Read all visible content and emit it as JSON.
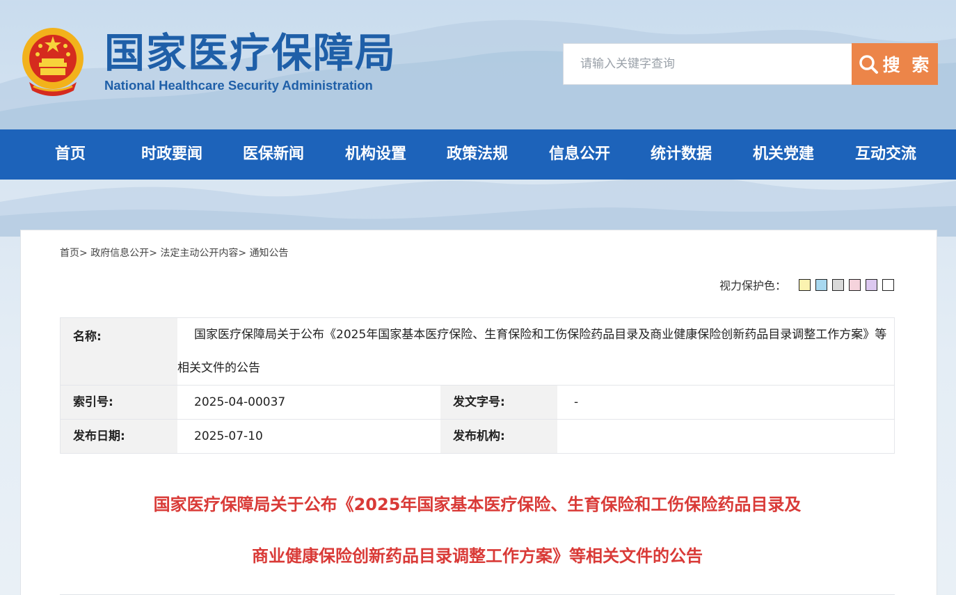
{
  "header": {
    "title_cn": "国家医疗保障局",
    "title_en": "National Healthcare Security Administration",
    "emblem_icon": "national-emblem-icon"
  },
  "search": {
    "placeholder": "请输入关键字查询",
    "button_label": "搜 索",
    "button_color": "#ec8549"
  },
  "nav": {
    "color": "#1d63ba",
    "items": [
      {
        "label": "首页"
      },
      {
        "label": "时政要闻"
      },
      {
        "label": "医保新闻"
      },
      {
        "label": "机构设置"
      },
      {
        "label": "政策法规"
      },
      {
        "label": "信息公开"
      },
      {
        "label": "统计数据"
      },
      {
        "label": "机关党建"
      },
      {
        "label": "互动交流"
      }
    ]
  },
  "breadcrumb": {
    "items": [
      {
        "label": "首页"
      },
      {
        "label": "政府信息公开"
      },
      {
        "label": "法定主动公开内容"
      },
      {
        "label": "通知公告"
      }
    ],
    "separator": ">"
  },
  "eye_care": {
    "label": "视力保护色：",
    "colors": [
      "#fbf3b0",
      "#a8d8f0",
      "#d9d9d9",
      "#f5d3dc",
      "#dcc8f0",
      "#ffffff"
    ]
  },
  "info_table": {
    "name_label": "名称:",
    "name_value": "国家医疗保障局关于公布《2025年国家基本医疗保险、生育保险和工伤保险药品目录及商业健康保险创新药品目录调整工作方案》等相关文件的公告",
    "index_label": "索引号:",
    "index_value": "2025-04-00037",
    "doc_no_label": "发文字号:",
    "doc_no_value": "-",
    "date_label": "发布日期:",
    "date_value": "2025-07-10",
    "org_label": "发布机构:",
    "org_value": ""
  },
  "document": {
    "title_line1": "国家医疗保障局关于公布《2025年国家基本医疗保险、生育保险和工伤保险药品目录及",
    "title_line2": "商业健康保险创新药品目录调整工作方案》等相关文件的公告",
    "title_color": "#d93a37"
  }
}
